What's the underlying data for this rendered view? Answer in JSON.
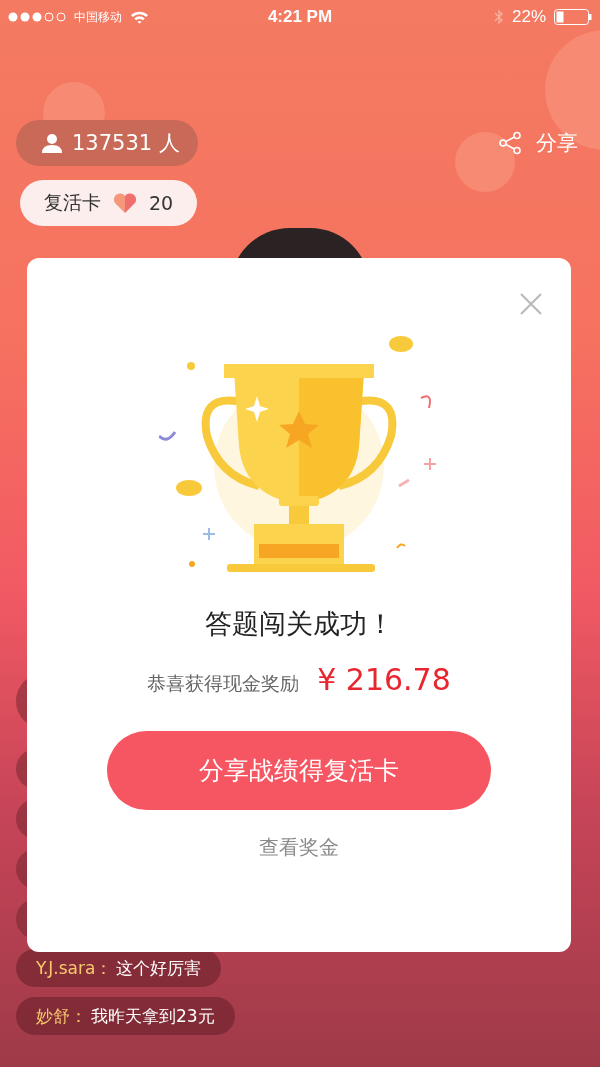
{
  "status_bar": {
    "carrier": "中国移动",
    "time": "4:21 PM",
    "battery": "22%"
  },
  "header": {
    "online_count": "137531 人",
    "share": "分享"
  },
  "revive_card": {
    "label": "复活卡",
    "count": "20"
  },
  "dialog": {
    "title": "答题闯关成功！",
    "reward_label": "恭喜获得现金奖励",
    "amount": "¥ 216.78",
    "primary_button": "分享战绩得复活卡",
    "link": "查看奖金"
  },
  "comments": [
    {
      "user": "Y.J.sara：",
      "text": "这个好厉害"
    },
    {
      "user": "妙舒：",
      "text": "我昨天拿到23元"
    }
  ]
}
